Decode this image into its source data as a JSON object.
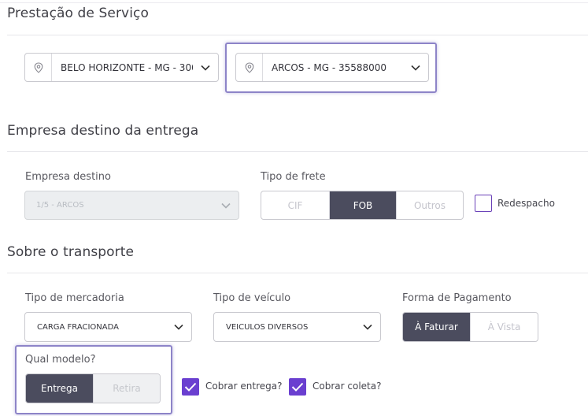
{
  "sections": {
    "servico": "Prestação de Serviço",
    "destino": "Empresa destino da entrega",
    "transporte": "Sobre o transporte"
  },
  "servico": {
    "origem_value": "BELO HORIZONTE - MG - 300000...",
    "destino_value": "ARCOS - MG - 35588000"
  },
  "destino": {
    "empresa_label": "Empresa destino",
    "empresa_value": "1/5 - ARCOS",
    "frete_label": "Tipo de frete",
    "frete_options": [
      "CIF",
      "FOB",
      "Outros"
    ],
    "frete_selected": "FOB",
    "redespacho_label": "Redespacho",
    "redespacho_checked": false
  },
  "transporte": {
    "mercadoria_label": "Tipo de mercadoria",
    "mercadoria_value": "CARGA FRACIONADA",
    "veiculo_label": "Tipo de veículo",
    "veiculo_value": "VEICULOS DIVERSOS",
    "pagamento_label": "Forma de Pagamento",
    "pagamento_options": [
      "À Faturar",
      "À Vista"
    ],
    "pagamento_selected": "À Faturar",
    "modelo_label": "Qual modelo?",
    "modelo_options": [
      "Entrega",
      "Retira"
    ],
    "modelo_selected": "Entrega",
    "cobrar_entrega_label": "Cobrar entrega?",
    "cobrar_entrega_checked": true,
    "cobrar_coleta_label": "Cobrar coleta?",
    "cobrar_coleta_checked": true
  },
  "colors": {
    "accent": "#6a3fd0",
    "active_segment": "#4b4c5e",
    "highlight": "#8d84c8"
  }
}
